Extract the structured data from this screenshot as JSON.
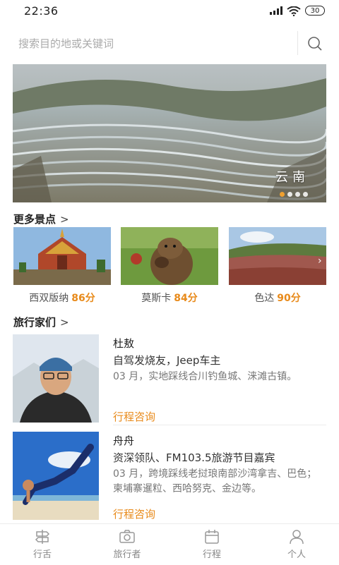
{
  "status": {
    "time": "22:36",
    "battery": "30"
  },
  "search": {
    "placeholder": "搜索目的地或关键词"
  },
  "banner": {
    "city": "云南",
    "dots": 4,
    "active_dot": 0
  },
  "spots": {
    "title": "更多景点",
    "items": [
      {
        "name": "西双版纳",
        "score": "86分"
      },
      {
        "name": "莫斯卡",
        "score": "84分"
      },
      {
        "name": "色达",
        "score": "90分"
      }
    ]
  },
  "travelers": {
    "title": "旅行家们",
    "items": [
      {
        "name": "杜敖",
        "title": "自驾发烧友，Jeep车主",
        "desc": "03 月，实地踩线合川钓鱼城、涞滩古镇。",
        "action": "行程咨询"
      },
      {
        "name": "舟舟",
        "title": "资深领队、FM103.5旅游节目嘉宾",
        "desc": "03 月，跨境踩线老挝琅南部沙湾拿吉、巴色；柬埔寨暹粒、西哈努克、金边等。",
        "action": "行程咨询"
      }
    ]
  },
  "tabs": [
    {
      "label": "行舌",
      "icon": "signpost-icon"
    },
    {
      "label": "旅行者",
      "icon": "camera-icon"
    },
    {
      "label": "行程",
      "icon": "calendar-icon"
    },
    {
      "label": "个人",
      "icon": "person-icon"
    }
  ]
}
